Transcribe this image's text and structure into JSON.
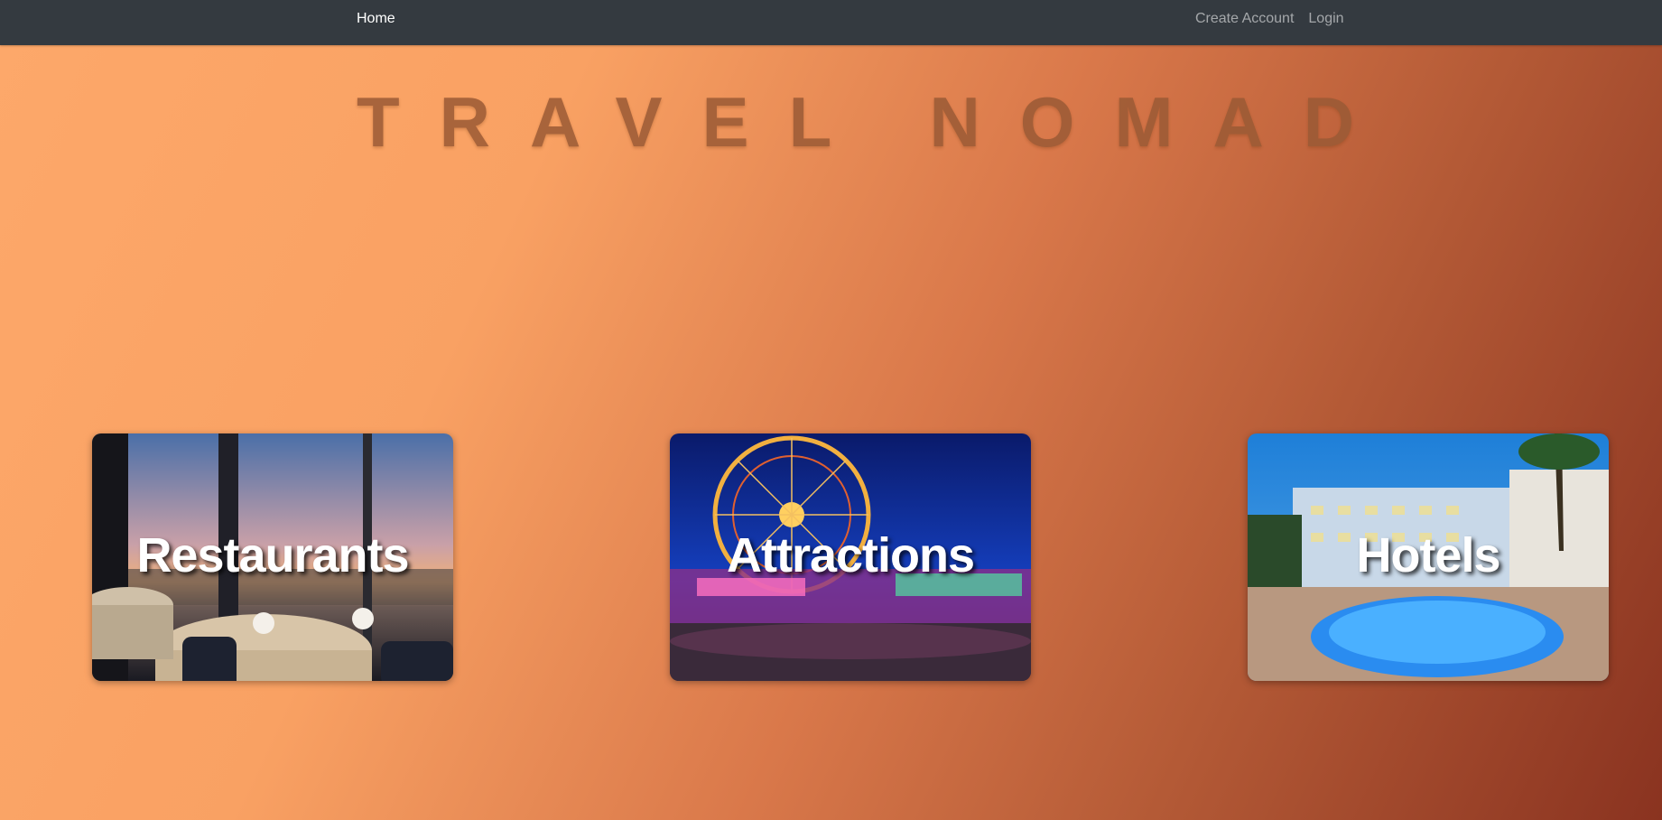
{
  "nav": {
    "home_label": "Home",
    "create_account_label": "Create Account",
    "login_label": "Login"
  },
  "hero": {
    "title": "TRAVEL NOMAD"
  },
  "cards": [
    {
      "label": "Restaurants"
    },
    {
      "label": "Attractions"
    },
    {
      "label": "Hotels"
    }
  ],
  "colors": {
    "navbar": "#343a40",
    "gradient_start": "#fda86a",
    "gradient_end": "#8a3320",
    "title": "#9a5a35"
  }
}
